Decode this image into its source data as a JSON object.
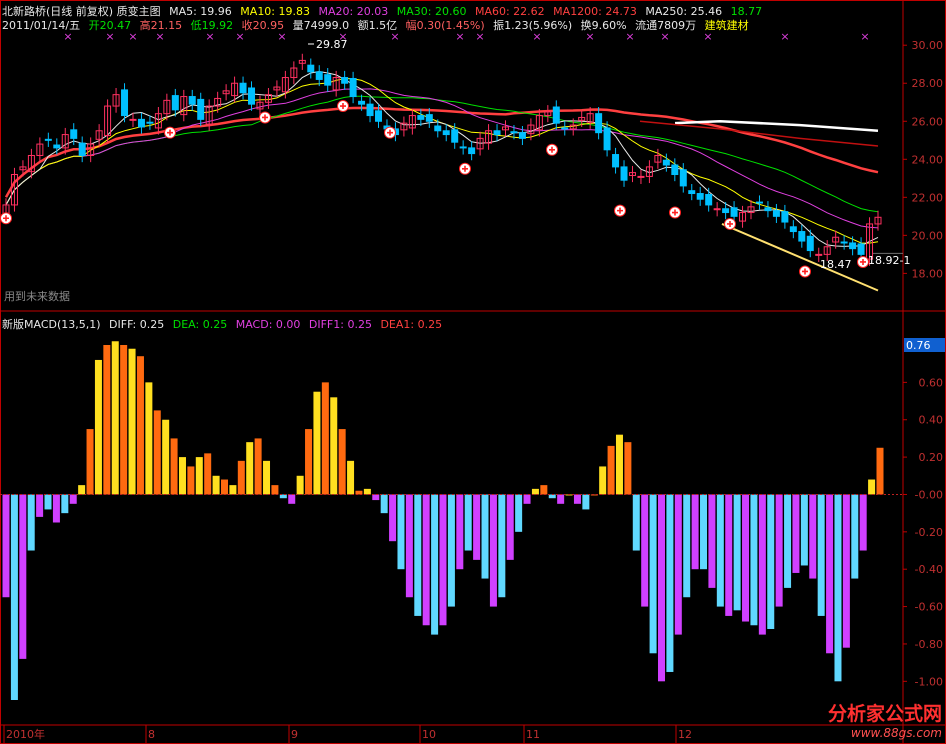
{
  "header": {
    "title": "北新路桥(日线 前复权) 质变主图",
    "ma": [
      {
        "label": "MA5: 19.96",
        "arrow": "↑",
        "color": "#e8e8e8"
      },
      {
        "label": "MA10: 19.83",
        "arrow": "↑",
        "color": "#ffff00"
      },
      {
        "label": "MA20: 20.03",
        "arrow": "↓",
        "color": "#e040e0"
      },
      {
        "label": "MA30: 20.60",
        "arrow": "↓",
        "color": "#00e000"
      },
      {
        "label": "MA60: 22.62",
        "arrow": "↓",
        "color": "#ff4040"
      },
      {
        "label": "MA1200: 24.73",
        "arrow": "↓",
        "color": "#ff4040"
      },
      {
        "label": "MA250: 25.46",
        "arrow": "↓",
        "color": "#e8e8e8"
      },
      {
        "label": "18.77",
        "arrow": "↓",
        "color": "#40c0ff"
      }
    ],
    "quote": {
      "date": "2011/01/14/五",
      "open": "开20.47",
      "high": "高21.15",
      "low": "低19.92",
      "close": "收20.95",
      "volume": "量74999.0",
      "amount": "额1.5亿",
      "change": "幅0.30(1.45%)",
      "amplitude": "振1.23(5.96%)",
      "turnover": "换9.60%",
      "float": "流通7809万",
      "sector": "建筑建材"
    },
    "watermark": "用到未来数据",
    "chart_labels": {
      "peak": "29.87",
      "low1": "18.47",
      "low2": "18.92-1"
    }
  },
  "macd_header": {
    "name": "新版MACD(13,5,1)",
    "diff": "DIFF: 0.25",
    "dea": "DEA: 0.25",
    "macd": "MACD: 0.00",
    "diff1": "DIFF1: 0.25",
    "dea1": "DEA1: 0.25"
  },
  "colors": {
    "bg": "#000000",
    "up": "#ff3060",
    "down": "#00c0ff",
    "grid": "#c00000",
    "macd_pos": "#ff6a10",
    "macd_pos2": "#ffe020",
    "macd_neg": "#d040ff",
    "macd_neg2": "#60d8ff",
    "ma5": "#e8e8e8",
    "ma10": "#ffff00",
    "ma20": "#e040e0",
    "ma30": "#00e000",
    "ma60": "#ff4040",
    "ma250": "#ffffff"
  },
  "chart_data": [
    {
      "type": "candlestick",
      "title": "北新路桥(日线 前复权)",
      "ylim": [
        16.6,
        30.8
      ],
      "y_ticks": [
        "30.00",
        "28.00",
        "26.00",
        "24.00",
        "22.00",
        "20.00",
        "18.00"
      ],
      "x_labels": [
        "2010年",
        "8",
        "9",
        "10",
        "11",
        "12"
      ],
      "candles_close": [
        21.6,
        23.2,
        23.6,
        24.2,
        24.8,
        25.0,
        24.6,
        25.3,
        25.1,
        24.2,
        24.8,
        25.5,
        26.8,
        27.4,
        26.3,
        26.1,
        25.7,
        25.9,
        26.4,
        27.1,
        26.6,
        27.3,
        26.9,
        26.1,
        26.8,
        27.2,
        27.6,
        28.0,
        27.5,
        26.9,
        27.0,
        27.4,
        27.8,
        28.3,
        28.8,
        29.2,
        28.6,
        28.2,
        27.9,
        28.3,
        28.0,
        27.3,
        26.9,
        26.3,
        26.0,
        25.6,
        25.3,
        25.9,
        26.3,
        26.1,
        26.0,
        25.5,
        25.3,
        24.9,
        24.6,
        24.3,
        25.1,
        25.5,
        25.3,
        25.7,
        25.4,
        25.1,
        25.8,
        26.3,
        26.5,
        25.9,
        25.6,
        25.8,
        26.2,
        26.4,
        25.4,
        24.5,
        23.6,
        22.9,
        23.3,
        23.1,
        23.6,
        24.2,
        23.7,
        23.2,
        22.6,
        22.2,
        21.9,
        21.6,
        21.4,
        21.2,
        21.0,
        21.2,
        21.5,
        21.7,
        21.3,
        21.0,
        20.7,
        20.2,
        19.7,
        19.2,
        19.0,
        19.4,
        19.9,
        19.6,
        19.3,
        19.0,
        20.6,
        20.95
      ],
      "ma5_last": 19.96,
      "ma10_last": 19.83,
      "ma20_last": 20.03,
      "ma30_last": 20.6,
      "ma60_last": 22.62,
      "ma250_last": 25.46
    },
    {
      "type": "bar",
      "title": "新版MACD(13,5,1)",
      "ylim": [
        -1.1,
        0.8
      ],
      "y_ticks": [
        "0.60",
        "0.40",
        "0.20",
        "-0.00",
        "-0.20",
        "-0.40",
        "-0.60",
        "-0.80",
        "-1.00"
      ],
      "current_label": "0.76",
      "values": [
        -0.55,
        -1.1,
        -0.88,
        -0.3,
        -0.12,
        -0.08,
        -0.15,
        -0.1,
        -0.05,
        0.05,
        0.35,
        0.72,
        0.8,
        0.82,
        0.8,
        0.78,
        0.74,
        0.6,
        0.45,
        0.4,
        0.3,
        0.2,
        0.15,
        0.2,
        0.22,
        0.1,
        0.08,
        0.05,
        0.18,
        0.28,
        0.3,
        0.18,
        0.05,
        -0.02,
        -0.05,
        0.1,
        0.35,
        0.55,
        0.6,
        0.52,
        0.35,
        0.18,
        0.02,
        0.03,
        -0.03,
        -0.1,
        -0.25,
        -0.4,
        -0.55,
        -0.65,
        -0.7,
        -0.75,
        -0.7,
        -0.6,
        -0.4,
        -0.3,
        -0.35,
        -0.45,
        -0.6,
        -0.55,
        -0.35,
        -0.2,
        -0.05,
        0.03,
        0.05,
        -0.02,
        -0.05,
        0.0,
        -0.05,
        -0.08,
        0.0,
        0.15,
        0.26,
        0.32,
        0.28,
        -0.3,
        -0.6,
        -0.85,
        -1.0,
        -0.95,
        -0.75,
        -0.55,
        -0.4,
        -0.4,
        -0.5,
        -0.6,
        -0.65,
        -0.62,
        -0.68,
        -0.7,
        -0.75,
        -0.72,
        -0.6,
        -0.5,
        -0.42,
        -0.38,
        -0.45,
        -0.65,
        -0.85,
        -1.0,
        -0.82,
        -0.45,
        -0.3,
        0.08,
        0.25
      ],
      "legend": [
        "DIFF: 0.25",
        "DEA: 0.25",
        "MACD: 0.00",
        "DIFF1: 0.25",
        "DEA1: 0.25"
      ]
    }
  ]
}
